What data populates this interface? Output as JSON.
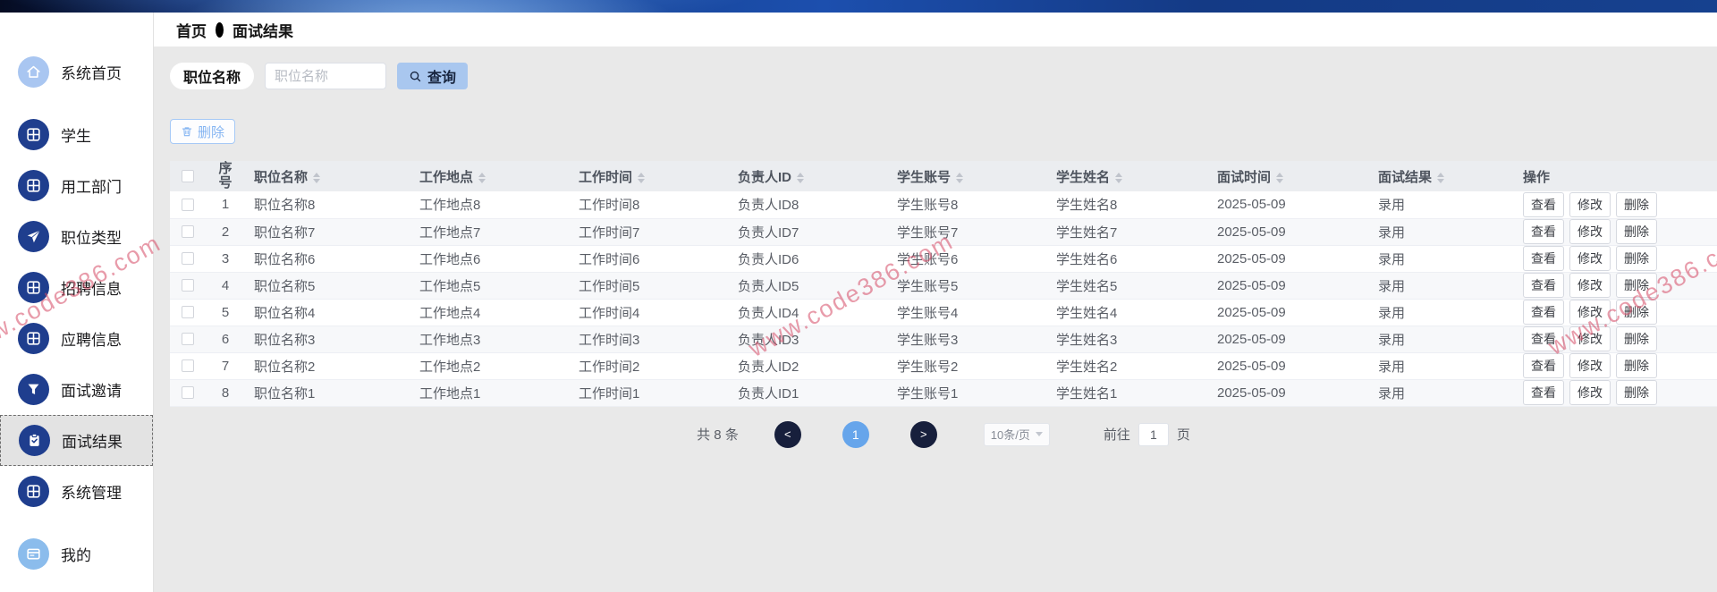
{
  "app": {
    "watermark_text": "www.code386.com"
  },
  "breadcrumb": {
    "home": "首页",
    "current": "面试结果"
  },
  "sidebar": {
    "items": [
      {
        "label": "系统首页",
        "icon": "home-icon",
        "variant": "light"
      },
      {
        "label": "学生",
        "icon": "grid-icon",
        "variant": "dark"
      },
      {
        "label": "用工部门",
        "icon": "grid-icon",
        "variant": "dark"
      },
      {
        "label": "职位类型",
        "icon": "send-icon",
        "variant": "dark"
      },
      {
        "label": "招聘信息",
        "icon": "grid-icon",
        "variant": "dark"
      },
      {
        "label": "应聘信息",
        "icon": "grid-icon",
        "variant": "dark"
      },
      {
        "label": "面试邀请",
        "icon": "funnel-icon",
        "variant": "dark"
      },
      {
        "label": "面试结果",
        "icon": "clipboard-icon",
        "variant": "dark",
        "selected": true
      },
      {
        "label": "系统管理",
        "icon": "grid-icon",
        "variant": "dark"
      },
      {
        "label": "我的",
        "icon": "card-icon",
        "variant": "lighter"
      }
    ]
  },
  "search": {
    "field_label": "职位名称",
    "placeholder": "职位名称",
    "query_button": "查询"
  },
  "toolbar": {
    "delete_button": "删除"
  },
  "table": {
    "columns": [
      {
        "label": "序号",
        "sortable": false,
        "wrap": true,
        "center": true
      },
      {
        "label": "职位名称",
        "sortable": true
      },
      {
        "label": "工作地点",
        "sortable": true
      },
      {
        "label": "工作时间",
        "sortable": true
      },
      {
        "label": "负责人ID",
        "sortable": true
      },
      {
        "label": "学生账号",
        "sortable": true
      },
      {
        "label": "学生姓名",
        "sortable": true
      },
      {
        "label": "面试时间",
        "sortable": true
      },
      {
        "label": "面试结果",
        "sortable": true
      },
      {
        "label": "操作",
        "sortable": false
      }
    ],
    "rows": [
      {
        "index": "1",
        "position_name": "职位名称8",
        "work_location": "工作地点8",
        "work_time": "工作时间8",
        "manager_id": "负责人ID8",
        "student_account": "学生账号8",
        "student_name": "学生姓名8",
        "interview_time": "2025-05-09",
        "interview_result": "录用"
      },
      {
        "index": "2",
        "position_name": "职位名称7",
        "work_location": "工作地点7",
        "work_time": "工作时间7",
        "manager_id": "负责人ID7",
        "student_account": "学生账号7",
        "student_name": "学生姓名7",
        "interview_time": "2025-05-09",
        "interview_result": "录用"
      },
      {
        "index": "3",
        "position_name": "职位名称6",
        "work_location": "工作地点6",
        "work_time": "工作时间6",
        "manager_id": "负责人ID6",
        "student_account": "学生账号6",
        "student_name": "学生姓名6",
        "interview_time": "2025-05-09",
        "interview_result": "录用"
      },
      {
        "index": "4",
        "position_name": "职位名称5",
        "work_location": "工作地点5",
        "work_time": "工作时间5",
        "manager_id": "负责人ID5",
        "student_account": "学生账号5",
        "student_name": "学生姓名5",
        "interview_time": "2025-05-09",
        "interview_result": "录用"
      },
      {
        "index": "5",
        "position_name": "职位名称4",
        "work_location": "工作地点4",
        "work_time": "工作时间4",
        "manager_id": "负责人ID4",
        "student_account": "学生账号4",
        "student_name": "学生姓名4",
        "interview_time": "2025-05-09",
        "interview_result": "录用"
      },
      {
        "index": "6",
        "position_name": "职位名称3",
        "work_location": "工作地点3",
        "work_time": "工作时间3",
        "manager_id": "负责人ID3",
        "student_account": "学生账号3",
        "student_name": "学生姓名3",
        "interview_time": "2025-05-09",
        "interview_result": "录用"
      },
      {
        "index": "7",
        "position_name": "职位名称2",
        "work_location": "工作地点2",
        "work_time": "工作时间2",
        "manager_id": "负责人ID2",
        "student_account": "学生账号2",
        "student_name": "学生姓名2",
        "interview_time": "2025-05-09",
        "interview_result": "录用"
      },
      {
        "index": "8",
        "position_name": "职位名称1",
        "work_location": "工作地点1",
        "work_time": "工作时间1",
        "manager_id": "负责人ID1",
        "student_account": "学生账号1",
        "student_name": "学生姓名1",
        "interview_time": "2025-05-09",
        "interview_result": "录用"
      }
    ],
    "actions": [
      "查看",
      "修改",
      "删除"
    ]
  },
  "pagination": {
    "total": "共 8 条",
    "prev": "<",
    "page": "1",
    "next": ">",
    "page_size": "10条/页",
    "goto_label": "前往",
    "goto_value": "1",
    "goto_suffix": "页"
  },
  "colors": {
    "navy": "#1f3e8e",
    "light_blue": "#a9c6f1",
    "lighter_blue": "#8bbcec",
    "query_bg": "#a9c7ef",
    "pg_dark": "#171f3c",
    "pg_active": "#66a5eb",
    "watermark": "#d64b66"
  }
}
